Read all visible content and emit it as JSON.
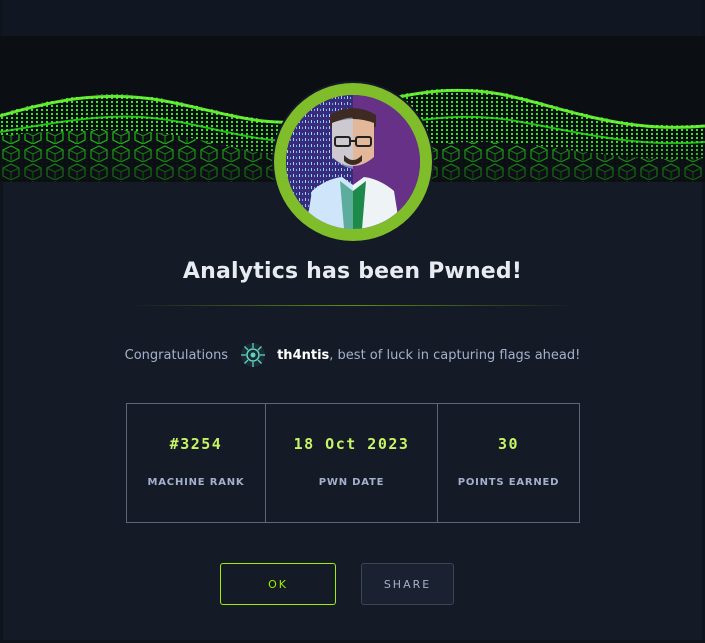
{
  "dialog": {
    "title": "Analytics has been Pwned!",
    "congrats_prefix": "Congratulations",
    "username": "th4ntis",
    "congrats_suffix": ", best of luck in capturing flags ahead!"
  },
  "stats": [
    {
      "value": "#3254",
      "label": "MACHINE RANK"
    },
    {
      "value": "18 Oct 2023",
      "label": "PWN DATE"
    },
    {
      "value": "30",
      "label": "POINTS EARNED"
    }
  ],
  "buttons": {
    "ok_label": "OK",
    "share_label": "SHARE"
  },
  "colors": {
    "accent": "#9fef00",
    "stat_value": "#c5f467",
    "background": "#141a26",
    "text_muted": "#a4b1cd",
    "avatar_ring": "#7fbd2b"
  },
  "icons": {
    "banner": "green-cube-wave-banner",
    "avatar": "machine-avatar",
    "user_avatar": "user-avatar-icon"
  }
}
